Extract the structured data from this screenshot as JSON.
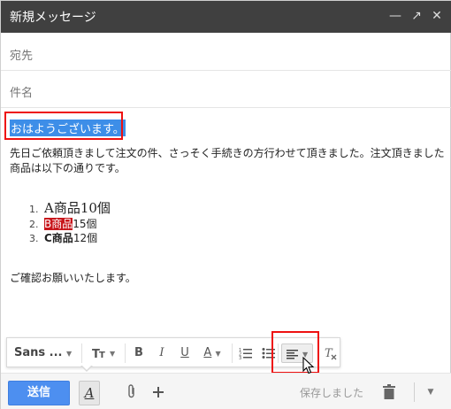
{
  "window": {
    "title": "新規メッセージ",
    "controls": {
      "minimize": "—",
      "popout": "↗",
      "close": "✕"
    }
  },
  "fields": {
    "to_label": "宛先",
    "subject_label": "件名"
  },
  "body": {
    "greeting": "おはようございます。",
    "paragraph": "先日ご依頼頂きまして注文の件、さっそく手続きの方行わせて頂きました。注文頂きました商品は以下の通りです。",
    "list": [
      {
        "num": "1.",
        "text": "A商品10個"
      },
      {
        "num": "2.",
        "highlight": "B商品",
        "rest": "15個"
      },
      {
        "num": "3.",
        "bold": "C商品",
        "rest": "12個"
      }
    ],
    "closing": "ご確認お願いいたします。"
  },
  "format_toolbar": {
    "font": "Sans ...",
    "size_icon": "text-size-icon",
    "bold": "B",
    "italic": "I",
    "underline": "U",
    "text_color": "A",
    "numbered_list_icon": "numbered-list-icon",
    "bulleted_list_icon": "bulleted-list-icon",
    "align_icon": "align-icon",
    "clear_formatting_icon": "clear-formatting-icon"
  },
  "bottom_bar": {
    "send_label": "送信",
    "format_toggle": "A",
    "attach_icon": "paperclip-icon",
    "more_options_icon": "plus-icon",
    "status": "保存しました",
    "discard_icon": "trash-icon",
    "more_icon": "caret-down-icon"
  },
  "colors": {
    "titlebar": "#404040",
    "selection": "#3d8ee8",
    "highlight_red": "#c8151b",
    "send_button": "#4d8ff0",
    "annotation_box": "#ee1111"
  }
}
